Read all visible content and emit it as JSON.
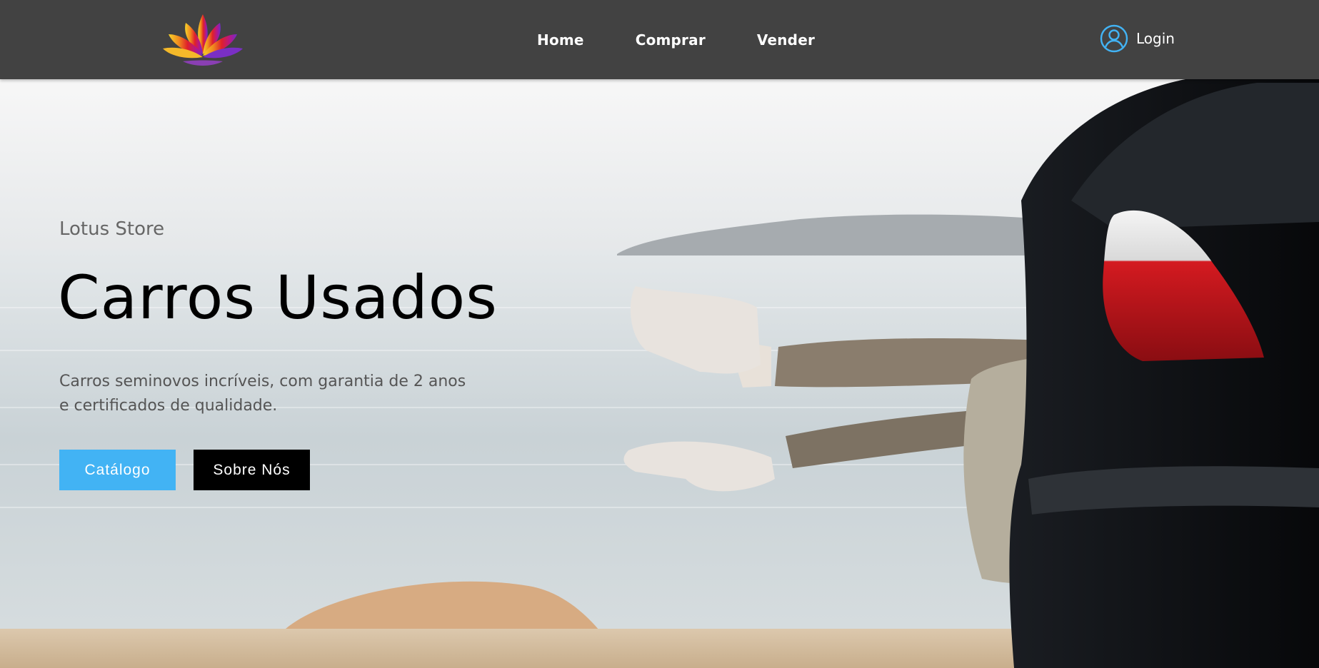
{
  "nav": {
    "logo_icon": "lotus-flower-logo",
    "links": [
      "Home",
      "Comprar",
      "Vender"
    ],
    "login_icon": "user-circle-icon",
    "login_label": "Login"
  },
  "hero": {
    "eyebrow": "Lotus Store",
    "title": "Carros Usados",
    "description_lines": [
      "Carros seminovos incríveis, com garantia de 2 anos",
      "e certificados de qualidade."
    ],
    "buttons": {
      "catalog": "Catálogo",
      "about": "Sobre Nós"
    }
  },
  "colors": {
    "navbar_bg": "#424242",
    "primary_button": "#42b3f4",
    "secondary_button": "#000000",
    "login_icon": "#42b3f4"
  }
}
